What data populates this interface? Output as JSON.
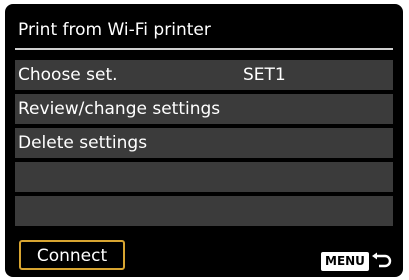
{
  "screen": {
    "title": "Print from Wi-Fi printer"
  },
  "menu": {
    "items": [
      {
        "label": "Choose set.",
        "value": "SET1"
      },
      {
        "label": "Review/change settings",
        "value": ""
      },
      {
        "label": "Delete settings",
        "value": ""
      },
      {
        "label": "",
        "value": ""
      },
      {
        "label": "",
        "value": ""
      }
    ]
  },
  "footer": {
    "connect_label": "Connect",
    "menu_button_label": "MENU",
    "back_icon": "back-arrow-icon"
  },
  "colors": {
    "background": "#000000",
    "row_background": "#3b3b3b",
    "accent": "#d8a531",
    "text": "#ffffff"
  }
}
